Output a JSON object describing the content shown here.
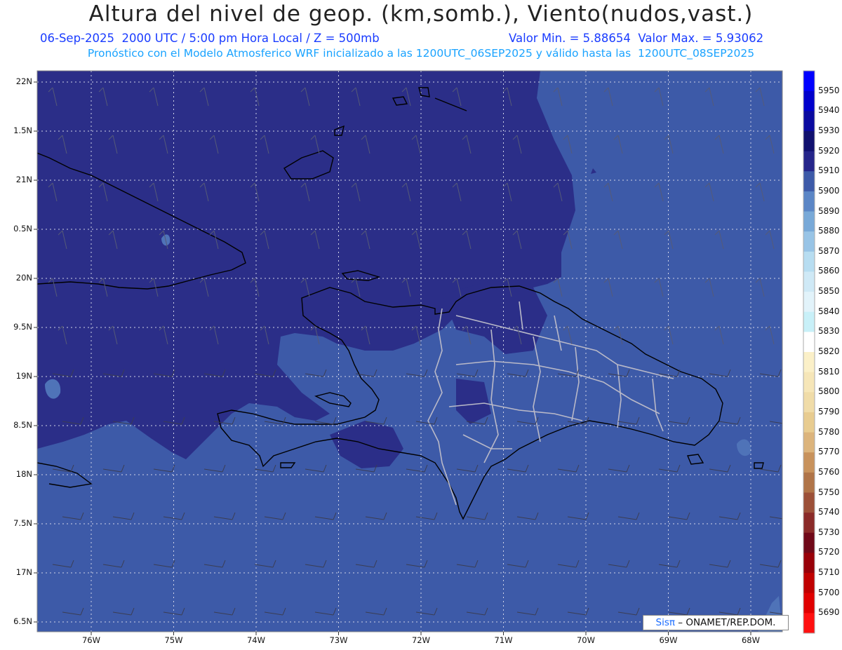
{
  "header": {
    "title": "Altura del nivel de geop. (km,somb.), Viento(nudos,vast.)",
    "info_left": "06-Sep-2025  2000 UTC / 5:00 pm Hora Local / Z = 500mb",
    "info_right": "Valor Min. = 5.88654  Valor Max. = 5.93062",
    "model_line": "Pronóstico con el Modelo Atmosferico WRF inicializado a las 1200UTC_06SEP2025 y válido hasta las  1200UTC_08SEP2025"
  },
  "map": {
    "lat_labels": [
      "22N",
      "1.5N",
      "21N",
      "0.5N",
      "20N",
      "9.5N",
      "19N",
      "8.5N",
      "18N",
      "7.5N",
      "17N",
      "6.5N"
    ],
    "lon_labels": [
      "76W",
      "75W",
      "74W",
      "73W",
      "72W",
      "71W",
      "70W",
      "69W",
      "68W"
    ],
    "colors": {
      "dark_zone": "#2b2e88",
      "mid_zone": "#3d5aa8",
      "light_zone": "#4f73b8",
      "coast": "#000000",
      "borders": "#b9b9c8",
      "grid": "#cfd3e6"
    }
  },
  "colorbar": {
    "levels": [
      "5950",
      "5940",
      "5930",
      "5920",
      "5910",
      "5900",
      "5890",
      "5880",
      "5870",
      "5860",
      "5850",
      "5840",
      "5830",
      "5820",
      "5810",
      "5800",
      "5790",
      "5780",
      "5770",
      "5760",
      "5750",
      "5740",
      "5730",
      "5720",
      "5710",
      "5700",
      "5690"
    ],
    "colors": [
      "#0000ff",
      "#0000cc",
      "#0a0aa0",
      "#10106e",
      "#25258a",
      "#3d5aa8",
      "#5b86c6",
      "#78a9d8",
      "#98c4e6",
      "#b7ddf1",
      "#cfe9f6",
      "#e2f3fa",
      "#c8f0f8",
      "#ffffff",
      "#fbf0c8",
      "#f6e6b8",
      "#f0dca8",
      "#e8cc90",
      "#dcb47c",
      "#c8925c",
      "#b07448",
      "#9c5038",
      "#8a2a28",
      "#700818",
      "#980008",
      "#c00000",
      "#e00000",
      "#ff1010"
    ]
  },
  "credit": {
    "brand": "Sisπ",
    "text": " – ONAMET/REP.DOM."
  }
}
